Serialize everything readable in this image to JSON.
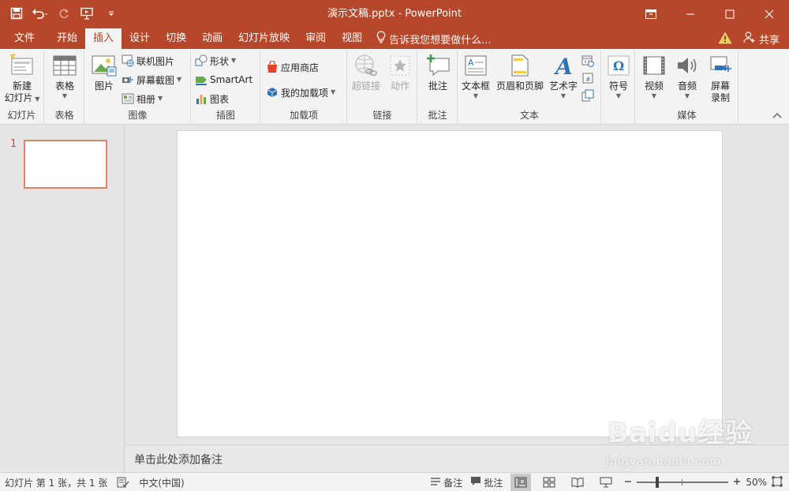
{
  "colors": {
    "accent": "#b7472a",
    "ribbon_bg": "#f3f3f3",
    "workspace_bg": "#e6e6e6",
    "thumb_border": "#e3826a",
    "slide_number": "#d24726"
  },
  "title_bar": {
    "doc_title": "演示文稿.pptx - PowerPoint"
  },
  "qat": {
    "save": "save-icon",
    "undo": "undo-icon",
    "redo": "redo-icon",
    "presenter": "present-from-beginning-icon",
    "customize": "customize-qat-icon"
  },
  "tabs": [
    "文件",
    "开始",
    "插入",
    "设计",
    "切换",
    "动画",
    "幻灯片放映",
    "审阅",
    "视图"
  ],
  "active_tab": "插入",
  "tell_me": "告诉我您想要做什么...",
  "share": "共享",
  "ribbon": {
    "slides": {
      "label": "幻灯片",
      "new_slide": [
        "新建",
        "幻灯片"
      ]
    },
    "tables": {
      "label": "表格",
      "table": "表格"
    },
    "images": {
      "label": "图像",
      "pictures": "图片",
      "online_pictures": "联机图片",
      "screenshot": "屏幕截图",
      "album": "相册"
    },
    "illustrations": {
      "label": "插图",
      "shapes": "形状",
      "smartart": "SmartArt",
      "chart": "图表"
    },
    "addins": {
      "label": "加载项",
      "store": "应用商店",
      "my_addins": "我的加载项"
    },
    "links": {
      "label": "链接",
      "hyperlink": "超链接",
      "action": "动作"
    },
    "comments": {
      "label": "批注",
      "comment": "批注"
    },
    "text": {
      "label": "文本",
      "textbox": "文本框",
      "header_footer": "页眉和页脚",
      "wordart": "艺术字"
    },
    "symbols": {
      "symbol": "符号"
    },
    "media": {
      "label": "媒体",
      "video": "视频",
      "audio": "音频",
      "screen_recording": [
        "屏幕",
        "录制"
      ]
    }
  },
  "thumbnails": [
    {
      "number": "1"
    }
  ],
  "notes_placeholder": "单击此处添加备注",
  "status": {
    "slide_info": "幻灯片 第 1 张，共 1 张",
    "language": "中文(中国)",
    "notes": "备注",
    "comments": "批注",
    "zoom_percent": "50%",
    "zoom_level": 50
  },
  "watermark": {
    "brand": "Baidu经验",
    "url": "jingyan.baidu.com"
  }
}
